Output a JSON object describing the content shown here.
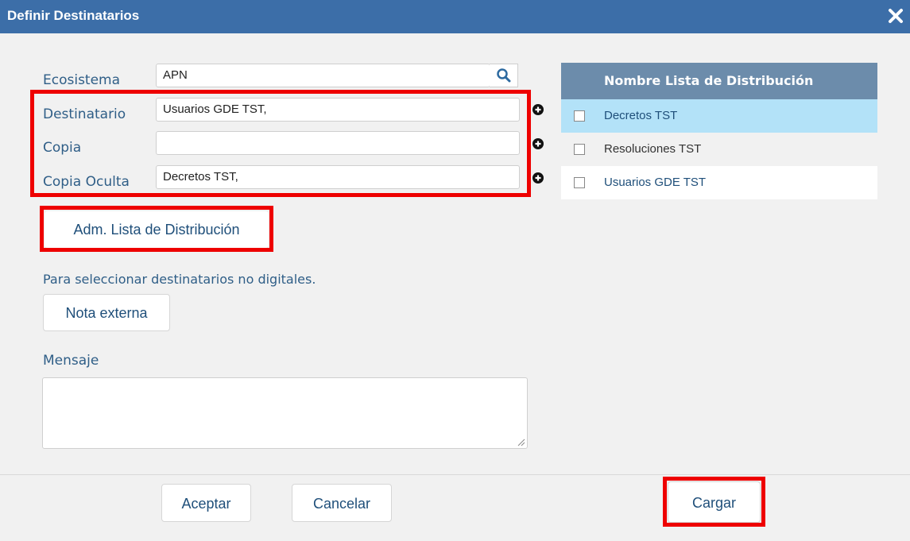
{
  "window": {
    "title": "Definir Destinatarios",
    "close_icon": "close-icon"
  },
  "form": {
    "ecosistema": {
      "label": "Ecosistema",
      "value": "APN"
    },
    "destinatario": {
      "label": "Destinatario",
      "value": "Usuarios GDE TST,"
    },
    "copia": {
      "label": "Copia",
      "value": ""
    },
    "copia_oculta": {
      "label": "Copia Oculta",
      "value": "Decretos TST,"
    }
  },
  "buttons": {
    "adm_lista": "Adm. Lista de Distribución",
    "nota_externa": "Nota externa",
    "aceptar": "Aceptar",
    "cancelar": "Cancelar",
    "cargar": "Cargar"
  },
  "hint": "Para seleccionar destinatarios no digitales.",
  "mensaje": {
    "label": "Mensaje",
    "value": ""
  },
  "distribution_table": {
    "header": "Nombre Lista de Distribución",
    "rows": [
      {
        "name": "Decretos TST",
        "checked": false,
        "highlighted": true
      },
      {
        "name": "Resoluciones TST",
        "checked": false,
        "highlighted": false
      },
      {
        "name": "Usuarios GDE TST",
        "checked": false,
        "highlighted": false
      }
    ]
  },
  "colors": {
    "titlebar": "#3c6ea8",
    "highlight_box": "#ee0000",
    "table_header": "#6c8cab",
    "row_selected": "#b3e2f8"
  }
}
